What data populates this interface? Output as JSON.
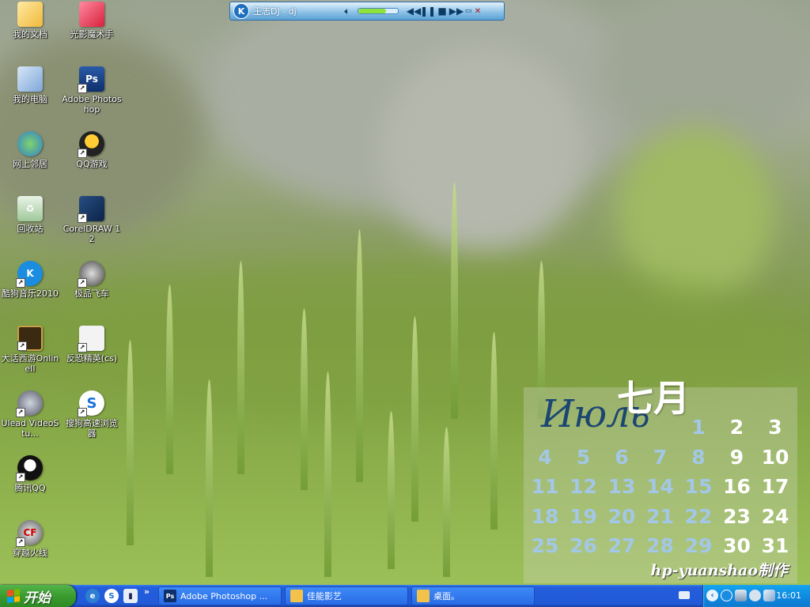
{
  "desktop": {
    "icons_col1": [
      {
        "label": "我的文档",
        "icon": "my-documents-folder-icon"
      },
      {
        "label": "我的电脑",
        "icon": "my-computer-icon"
      },
      {
        "label": "网上邻居",
        "icon": "network-places-icon"
      },
      {
        "label": "回收站",
        "icon": "recycle-bin-icon"
      },
      {
        "label": "酷狗音乐2010",
        "icon": "kugou-music-icon"
      },
      {
        "label": "大话西游OnlineII",
        "icon": "dahua-xiyou-icon"
      },
      {
        "label": "Ulead VideoStu...",
        "icon": "ulead-videostudio-icon"
      },
      {
        "label": "腾讯QQ",
        "icon": "qq-penguin-icon"
      },
      {
        "label": "穿越火线",
        "icon": "crossfire-icon"
      }
    ],
    "icons_col2": [
      {
        "label": "光影魔术手",
        "icon": "nevergrind-photo-icon"
      },
      {
        "label": "Adobe Photoshop",
        "icon": "photoshop-icon"
      },
      {
        "label": "QQ游戏",
        "icon": "qq-game-icon"
      },
      {
        "label": "CorelDRAW 12",
        "icon": "coreldraw-icon"
      },
      {
        "label": "极品飞车",
        "icon": "need-for-speed-icon"
      },
      {
        "label": "反恐精英(cs)",
        "icon": "counter-strike-icon"
      },
      {
        "label": "搜狗高速浏览器",
        "icon": "sogou-browser-icon"
      }
    ]
  },
  "player": {
    "logo": "K",
    "track": "王志DJ - dj",
    "volume_fraction": 0.7
  },
  "calendar": {
    "month_ru": "Июль",
    "month_cn": "七月",
    "days": [
      1,
      2,
      3,
      4,
      5,
      6,
      7,
      8,
      9,
      10,
      11,
      12,
      13,
      14,
      15,
      16,
      17,
      18,
      19,
      20,
      21,
      22,
      23,
      24,
      25,
      26,
      27,
      28,
      29,
      30,
      31
    ],
    "weekend_days": [
      2,
      3,
      9,
      10,
      16,
      17,
      23,
      24,
      30,
      31
    ],
    "credit": "hp-yuanshao制作"
  },
  "taskbar": {
    "start_label": "开始",
    "more_chevron": "»",
    "tasks": [
      {
        "label": "Adobe Photoshop ...",
        "icon": "photoshop-task-icon"
      },
      {
        "label": "佳能影艺",
        "icon": "canon-folder-task-icon"
      },
      {
        "label": "桌面。",
        "icon": "desktop-folder-task-icon"
      }
    ],
    "clock": "16:01"
  },
  "colors": {
    "taskbar_blue": "#245edc",
    "start_green": "#3a9b2f",
    "calendar_weekday": "#a3c7e6",
    "calendar_weekend": "#ffffff"
  }
}
